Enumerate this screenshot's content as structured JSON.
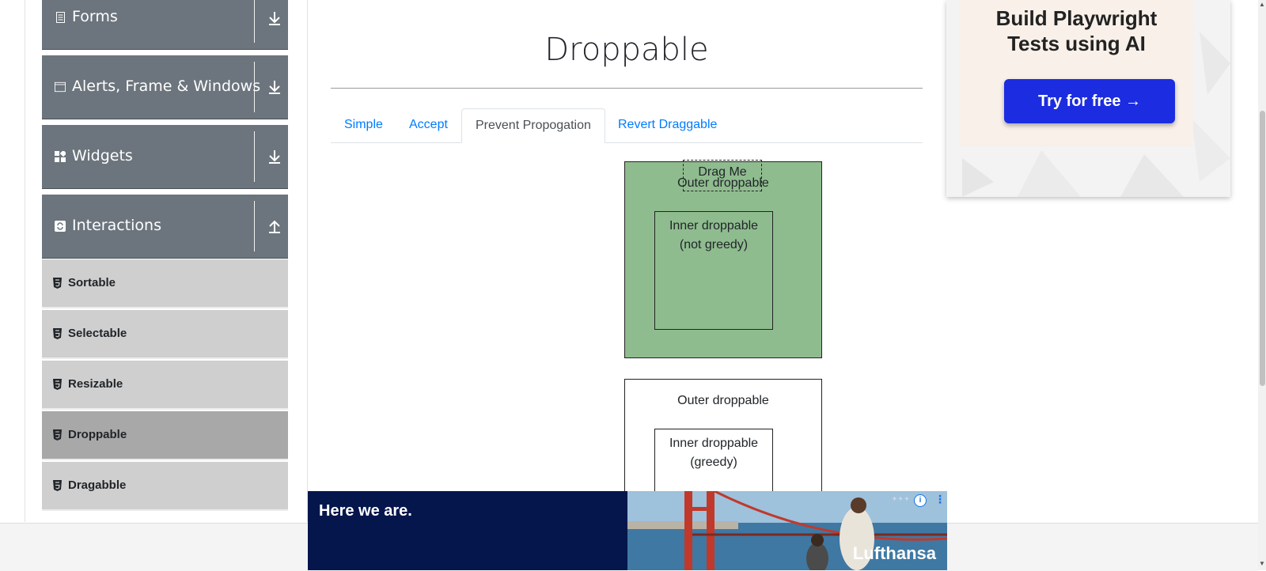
{
  "sidebar": {
    "groups": [
      {
        "label": "Forms",
        "icon": "form-icon",
        "arrow": "download-arrow-icon"
      },
      {
        "label": "Alerts, Frame & Windows",
        "icon": "window-icon",
        "arrow": "download-arrow-icon"
      },
      {
        "label": "Widgets",
        "icon": "widgets-icon",
        "arrow": "download-arrow-icon"
      },
      {
        "label": "Interactions",
        "icon": "interactions-icon",
        "arrow": "upload-arrow-icon"
      }
    ],
    "items": [
      {
        "label": "Sortable"
      },
      {
        "label": "Selectable"
      },
      {
        "label": "Resizable"
      },
      {
        "label": "Droppable",
        "active": true
      },
      {
        "label": "Dragabble"
      }
    ]
  },
  "main": {
    "title": "Droppable",
    "tabs": [
      {
        "label": "Simple"
      },
      {
        "label": "Accept"
      },
      {
        "label": "Prevent Propogation",
        "active": true
      },
      {
        "label": "Revert Draggable"
      }
    ],
    "drag_label": "Drag Me",
    "outer_label": "Outer droppable",
    "outer_label_2": "Outer droppable",
    "inner_not_greedy": [
      "Inner droppable",
      "(not greedy)"
    ],
    "inner_greedy": [
      "Inner droppable",
      "(greedy)"
    ]
  },
  "ad": {
    "title_line1": "Build Playwright",
    "title_line2": "Tests using AI",
    "button": "Try for free →"
  },
  "bottom_ad": {
    "headline": "Here we are.",
    "brand": "Lufthansa"
  },
  "colors": {
    "sidebar_group": "#6c757d",
    "sidebar_item": "#cfcfcf",
    "sidebar_item_active": "#a8a8a8",
    "tab_link": "#007bff",
    "droppable_active": "#8fbc8f",
    "ad_button": "#1c2ce0",
    "bottom_ad_navy": "#05164d"
  }
}
